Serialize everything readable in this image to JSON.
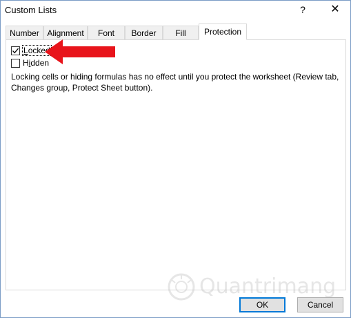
{
  "window": {
    "title": "Custom Lists",
    "help_label": "?",
    "close_label": "✕"
  },
  "tabs": [
    {
      "label": "Number",
      "active": false
    },
    {
      "label": "Alignment",
      "active": false
    },
    {
      "label": "Font",
      "active": false
    },
    {
      "label": "Border",
      "active": false
    },
    {
      "label": "Fill",
      "active": false
    },
    {
      "label": "Protection",
      "active": true
    }
  ],
  "protection": {
    "locked": {
      "prefix": "",
      "mnemonic": "L",
      "suffix": "ocked",
      "checked": true
    },
    "hidden": {
      "prefix": "H",
      "mnemonic": "i",
      "suffix": "dden",
      "checked": false
    },
    "info_text": "Locking cells or hiding formulas has no effect until you protect the worksheet (Review tab, Changes group, Protect Sheet button)."
  },
  "watermark": {
    "text": "Quantrimang",
    "color": "#b8b8b8"
  },
  "buttons": {
    "ok": "OK",
    "cancel": "Cancel"
  },
  "colors": {
    "arrow": "#e8141b",
    "focus_border": "#0078d7",
    "window_border": "#7a9cc6"
  }
}
